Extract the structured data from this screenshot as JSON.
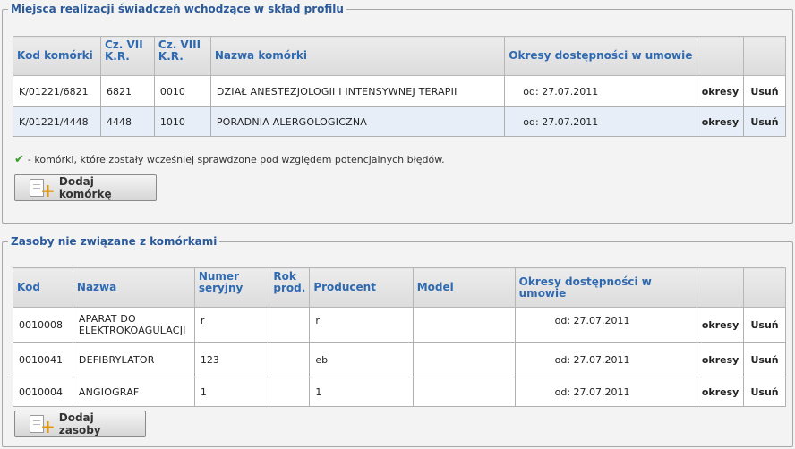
{
  "section1": {
    "legend": "Miejsca realizacji świadczeń wchodzące w skład profilu",
    "columns": [
      "Kod komórki",
      "Cz. VII K.R.",
      "Cz. VIII K.R.",
      "Nazwa komórki",
      "Okresy dostępności w umowie",
      "",
      ""
    ],
    "rows": [
      {
        "kod": "K/01221/6821",
        "cz7": "6821",
        "cz8": "0010",
        "nazwa": "DZIAŁ ANESTEZJOLOGII I INTENSYWNEJ TERAPII",
        "okresy": "od: 27.07.2011",
        "action1": "okresy",
        "action2": "Usuń"
      },
      {
        "kod": "K/01221/4448",
        "cz7": "4448",
        "cz8": "1010",
        "nazwa": "PORADNIA ALERGOLOGICZNA",
        "okresy": "od: 27.07.2011",
        "action1": "okresy",
        "action2": "Usuń"
      }
    ],
    "note": "- komórki, które zostały wcześniej sprawdzone pod względem potencjalnych błędów.",
    "add_button": "Dodaj komórkę"
  },
  "section2": {
    "legend": "Zasoby nie związane z komórkami",
    "columns": [
      "Kod",
      "Nazwa",
      "Numer seryjny",
      "Rok prod.",
      "Producent",
      "Model",
      "Okresy dostępności w umowie",
      "",
      ""
    ],
    "rows": [
      {
        "kod": "0010008",
        "nazwa": "APARAT DO ELEKTROKOAGULACJI",
        "numer": "r",
        "rok": "",
        "producent": "r",
        "model": "",
        "okresy": "od: 27.07.2011",
        "action1": "okresy",
        "action2": "Usuń"
      },
      {
        "kod": "0010041",
        "nazwa": "DEFIBRYLATOR",
        "numer": "123",
        "rok": "",
        "producent": "eb",
        "model": "",
        "okresy": "od: 27.07.2011",
        "action1": "okresy",
        "action2": "Usuń"
      },
      {
        "kod": "0010004",
        "nazwa": "ANGIOGRAF",
        "numer": "1",
        "rok": "",
        "producent": "1",
        "model": "",
        "okresy": "od: 27.07.2011",
        "action1": "okresy",
        "action2": "Usuń"
      }
    ],
    "add_button": "Dodaj zasoby"
  },
  "icons": {
    "check": "checkmark-icon",
    "add": "add-document-icon"
  },
  "colors": {
    "header_text": "#2f6ab0",
    "legend_text": "#2a5a9a",
    "alt_row": "#e7eef8",
    "check": "#3a9a2a"
  }
}
